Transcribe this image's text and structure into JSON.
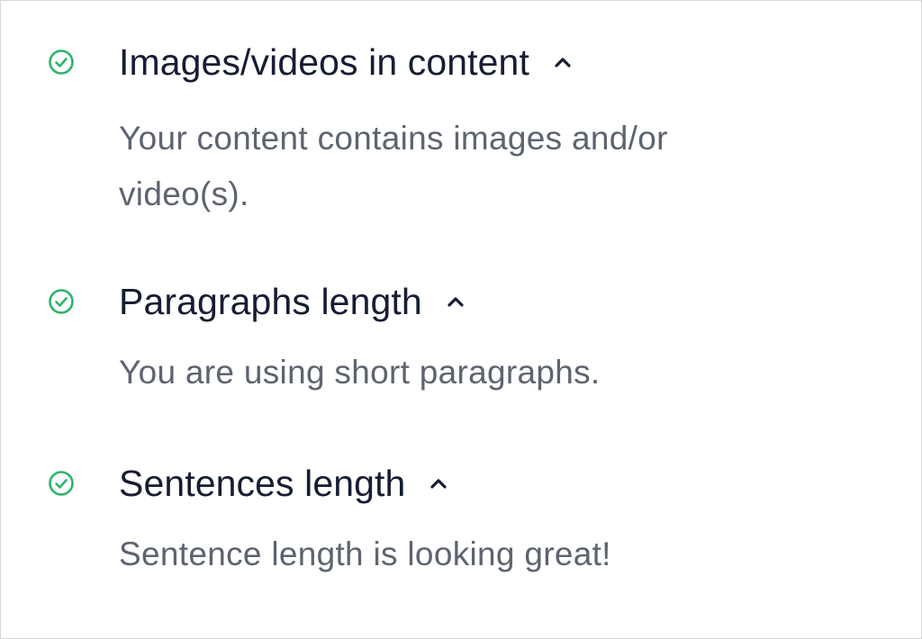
{
  "checks": [
    {
      "title": "Images/videos in content",
      "description": "Your content contains images and/or video(s).",
      "status": "passed",
      "expanded": true
    },
    {
      "title": "Paragraphs length",
      "description": "You are using short paragraphs.",
      "status": "passed",
      "expanded": true
    },
    {
      "title": "Sentences length",
      "description": "Sentence length is looking great!",
      "status": "passed",
      "expanded": true
    }
  ],
  "icons": {
    "status": "check-circle-icon",
    "toggle": "chevron-up-icon"
  },
  "colors": {
    "success": "#2fb36b",
    "title": "#161d33",
    "description": "#5d6470",
    "chevron": "#161d33",
    "border": "#d4d6da",
    "background": "#ffffff"
  }
}
